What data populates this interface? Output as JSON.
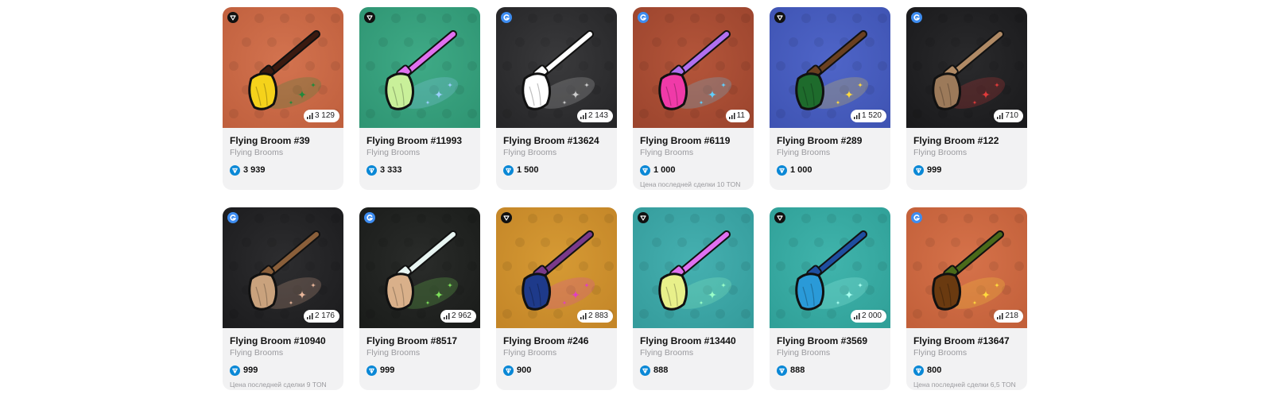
{
  "ton_icon": "ton-diamond-icon",
  "cards": [
    {
      "title": "Flying Broom #39",
      "collection": "Flying Brooms",
      "count": "3 129",
      "price": "3 939",
      "last_sale": "",
      "market": "dark",
      "bg": "#d3734f",
      "bg2": "#c0603e",
      "head": "#f5d21b",
      "handle": "#3a1a10",
      "accent": "#1f8a3b"
    },
    {
      "title": "Flying Broom #11993",
      "collection": "Flying Brooms",
      "count": "",
      "price": "3 333",
      "last_sale": "",
      "market": "dark",
      "bg": "#3faa86",
      "bg2": "#2f9573",
      "head": "#c9f09a",
      "handle": "#e070f0",
      "accent": "#9ad0ff"
    },
    {
      "title": "Flying Broom #13624",
      "collection": "Flying Brooms",
      "count": "2 143",
      "price": "1 500",
      "last_sale": "",
      "market": "blue",
      "bg": "#3a3a3c",
      "bg2": "#262628",
      "head": "#ffffff",
      "handle": "#ffffff",
      "accent": "#cccccc"
    },
    {
      "title": "Flying Broom #6119",
      "collection": "Flying Brooms",
      "count": "11",
      "price": "1 000",
      "last_sale": "Цена последней сделки 10 TON",
      "market": "blue",
      "bg": "#b4553a",
      "bg2": "#9c452e",
      "head": "#f03aa8",
      "handle": "#b070f0",
      "accent": "#5fd0ff"
    },
    {
      "title": "Flying Broom #289",
      "collection": "Flying Brooms",
      "count": "1 520",
      "price": "1 000",
      "last_sale": "",
      "market": "dark",
      "bg": "#4f65c8",
      "bg2": "#3f54b3",
      "head": "#1e6b2c",
      "handle": "#6a4020",
      "accent": "#ffd93d"
    },
    {
      "title": "Flying Broom #122",
      "collection": "Flying Brooms",
      "count": "710",
      "price": "999",
      "last_sale": "",
      "market": "blue",
      "bg": "#2a2a2c",
      "bg2": "#1a1a1c",
      "head": "#9c7a5a",
      "handle": "#b08a65",
      "accent": "#e03a3a"
    },
    {
      "title": "Flying Broom #10940",
      "collection": "Flying Brooms",
      "count": "2 176",
      "price": "999",
      "last_sale": "Цена последней сделки 9 TON",
      "market": "blue",
      "bg": "#2d2d2f",
      "bg2": "#1c1c1e",
      "head": "#c9a27d",
      "handle": "#8a5f3a",
      "accent": "#e8b69a"
    },
    {
      "title": "Flying Broom #8517",
      "collection": "Flying Brooms",
      "count": "2 962",
      "price": "999",
      "last_sale": "",
      "market": "blue",
      "bg": "#2a2c2a",
      "bg2": "#1a1c1a",
      "head": "#d9b08a",
      "handle": "#e8f5f2",
      "accent": "#7de05a"
    },
    {
      "title": "Flying Broom #246",
      "collection": "Flying Brooms",
      "count": "2 883",
      "price": "900",
      "last_sale": "",
      "market": "dark",
      "bg": "#d69a34",
      "bg2": "#c48628",
      "head": "#1e3a8a",
      "handle": "#7a3a8a",
      "accent": "#e040c0"
    },
    {
      "title": "Flying Broom #13440",
      "collection": "Flying Brooms",
      "count": "",
      "price": "888",
      "last_sale": "",
      "market": "dark",
      "bg": "#45b0b0",
      "bg2": "#359c9c",
      "head": "#e8f08a",
      "handle": "#e070f0",
      "accent": "#9affc8"
    },
    {
      "title": "Flying Broom #3569",
      "collection": "Flying Brooms",
      "count": "2 000",
      "price": "888",
      "last_sale": "",
      "market": "dark",
      "bg": "#40b4ac",
      "bg2": "#30a098",
      "head": "#2a9ad8",
      "handle": "#1f4ea0",
      "accent": "#a8fff0"
    },
    {
      "title": "Flying Broom #13647",
      "collection": "Flying Brooms",
      "count": "218",
      "price": "800",
      "last_sale": "Цена последней сделки 6,5 TON",
      "market": "blue",
      "bg": "#d6724a",
      "bg2": "#c2603a",
      "head": "#6a3a10",
      "handle": "#4a6a1a",
      "accent": "#ffd93d"
    }
  ]
}
